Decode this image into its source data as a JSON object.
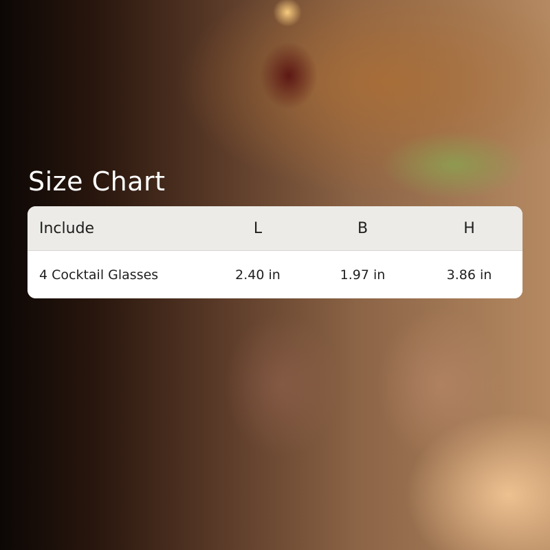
{
  "title": "Size Chart",
  "table": {
    "headers": [
      "Include",
      "L",
      "B",
      "H"
    ],
    "rows": [
      [
        "4 Cocktail Glasses",
        "2.40 in",
        "1.97 in",
        "3.86 in"
      ]
    ]
  }
}
